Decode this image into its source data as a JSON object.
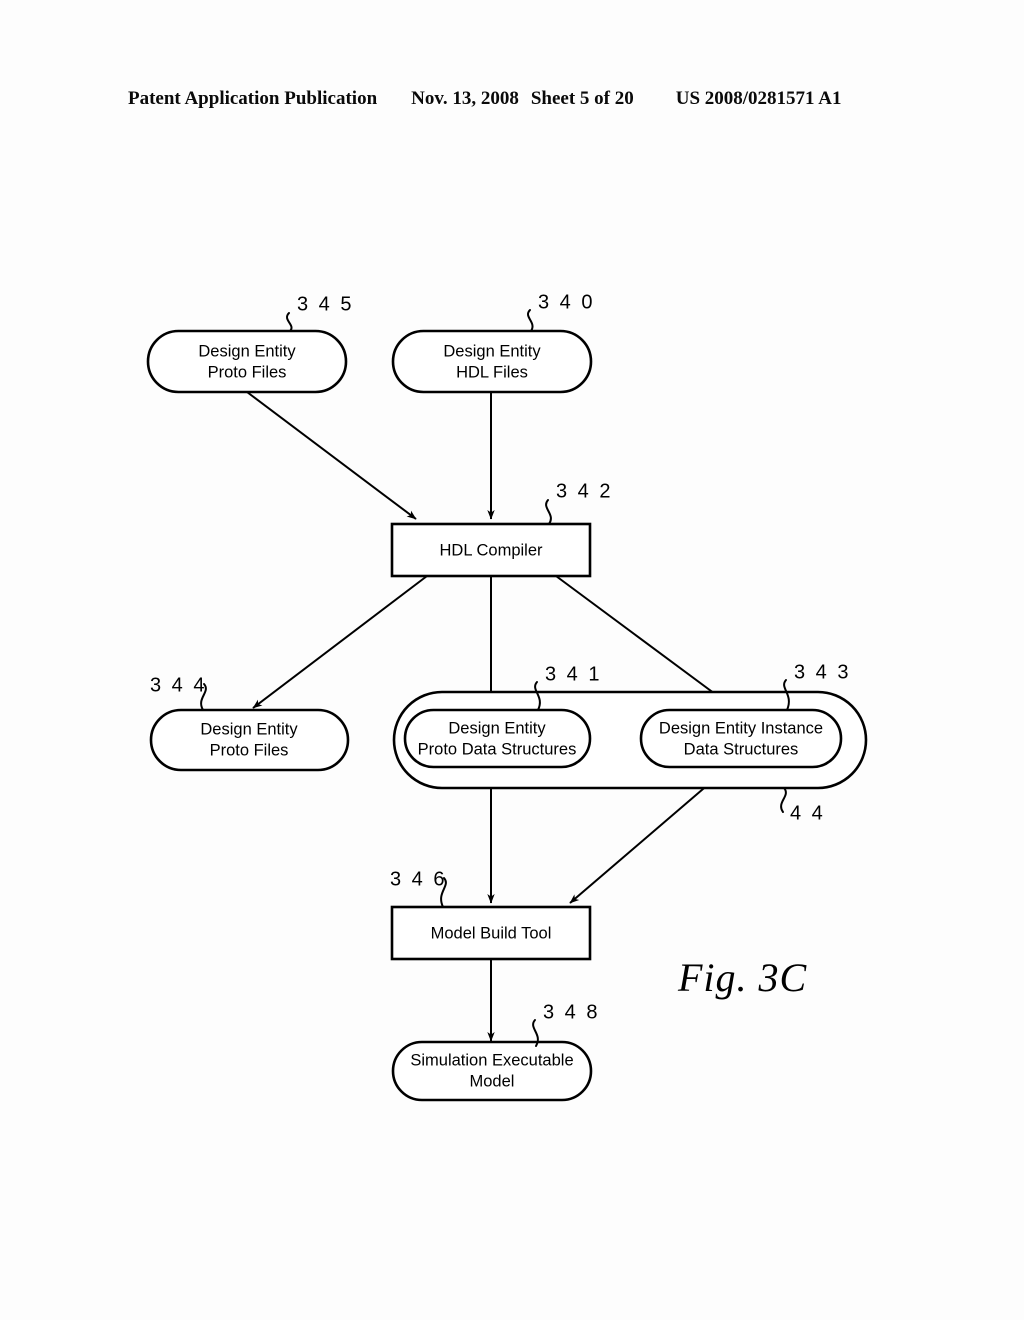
{
  "header": {
    "publication": "Patent Application Publication",
    "date": "Nov. 13, 2008",
    "sheet": "Sheet 5 of 20",
    "patent_number": "US 2008/0281571 A1"
  },
  "figure": {
    "caption": "Fig.  3C",
    "nodes": {
      "design_entity_proto_files_top": {
        "line1": "Design Entity",
        "line2": "Proto Files",
        "ref": "3 4 5",
        "shape": "rounded"
      },
      "design_entity_hdl_files": {
        "line1": "Design Entity",
        "line2": "HDL Files",
        "ref": "3 4 0",
        "shape": "rounded"
      },
      "hdl_compiler": {
        "line1": "HDL Compiler",
        "line2": "",
        "ref": "3 4 2",
        "shape": "rect"
      },
      "design_entity_proto_files_bottom": {
        "line1": "Design Entity",
        "line2": "Proto Files",
        "ref": "3 4 4",
        "shape": "rounded"
      },
      "design_entity_proto_data_structures": {
        "line1": "Design Entity",
        "line2": "Proto Data Structures",
        "ref": "3 4 1",
        "shape": "rounded"
      },
      "design_entity_instance_data_structures": {
        "line1": "Design Entity Instance",
        "line2": "Data Structures",
        "ref": "3 4 3",
        "shape": "rounded"
      },
      "data_structures_container": {
        "line1": "",
        "line2": "",
        "ref": "4 4",
        "shape": "rounded-container"
      },
      "model_build_tool": {
        "line1": "Model Build Tool",
        "line2": "",
        "ref": "3 4 6",
        "shape": "rect"
      },
      "simulation_executable_model": {
        "line1": "Simulation Executable",
        "line2": "Model",
        "ref": "3 4 8",
        "shape": "rounded"
      }
    },
    "edges": [
      {
        "from": "design_entity_proto_files_top",
        "to": "hdl_compiler"
      },
      {
        "from": "design_entity_hdl_files",
        "to": "hdl_compiler"
      },
      {
        "from": "hdl_compiler",
        "to": "design_entity_proto_files_bottom"
      },
      {
        "from": "hdl_compiler",
        "to": "design_entity_proto_data_structures"
      },
      {
        "from": "hdl_compiler",
        "to": "design_entity_instance_data_structures"
      },
      {
        "from": "design_entity_proto_data_structures",
        "to": "model_build_tool"
      },
      {
        "from": "design_entity_instance_data_structures",
        "to": "model_build_tool"
      },
      {
        "from": "model_build_tool",
        "to": "simulation_executable_model"
      }
    ]
  },
  "colors": {
    "ink": "#000000",
    "paper": "#ffffff"
  }
}
